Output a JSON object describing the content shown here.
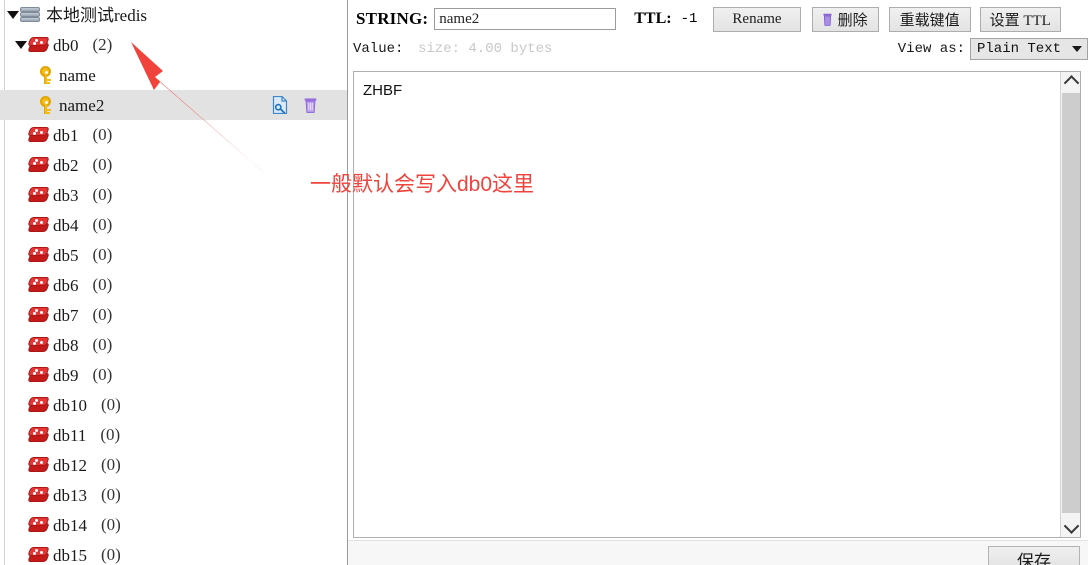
{
  "tree": {
    "root": {
      "label": "本地测试redis",
      "icon": "server-icon",
      "expanded": true
    },
    "db0": {
      "label": "db0",
      "count": "(2)",
      "icon": "database-icon",
      "expanded": true
    },
    "keys": [
      {
        "label": "name",
        "icon": "key-icon",
        "selected": false
      },
      {
        "label": "name2",
        "icon": "key-icon",
        "selected": true
      }
    ],
    "databases": [
      {
        "label": "db1",
        "count": "(0)"
      },
      {
        "label": "db2",
        "count": "(0)"
      },
      {
        "label": "db3",
        "count": "(0)"
      },
      {
        "label": "db4",
        "count": "(0)"
      },
      {
        "label": "db5",
        "count": "(0)"
      },
      {
        "label": "db6",
        "count": "(0)"
      },
      {
        "label": "db7",
        "count": "(0)"
      },
      {
        "label": "db8",
        "count": "(0)"
      },
      {
        "label": "db9",
        "count": "(0)"
      },
      {
        "label": "db10",
        "count": "(0)"
      },
      {
        "label": "db11",
        "count": "(0)"
      },
      {
        "label": "db12",
        "count": "(0)"
      },
      {
        "label": "db13",
        "count": "(0)"
      },
      {
        "label": "db14",
        "count": "(0)"
      },
      {
        "label": "db15",
        "count": "(0)"
      }
    ],
    "row_actions": {
      "edit_icon": "edit-document-icon",
      "delete_icon": "trash-icon"
    }
  },
  "toolbar": {
    "type_label": "STRING:",
    "key_value": "name2",
    "ttl_label": "TTL:",
    "ttl_value": "-1",
    "rename_label": "Rename",
    "delete_label": "删除",
    "delete_icon": "trash-icon",
    "reload_label": "重载键值",
    "set_ttl_label": "设置 TTL"
  },
  "subbar": {
    "value_label": "Value:",
    "size_text": "size: 4.00 bytes",
    "view_as_label": "View as:",
    "view_as_value": "Plain Text",
    "caret_icon": "chevron-down-icon"
  },
  "editor": {
    "content": "ZHBF",
    "scroll_up_icon": "chevron-up-icon",
    "scroll_down_icon": "chevron-down-icon"
  },
  "footer": {
    "save_label": "保存"
  },
  "annotation": {
    "text": "一般默认会写入db0这里",
    "color": "#f0433c",
    "arrow_icon": "arrow-pointer"
  }
}
